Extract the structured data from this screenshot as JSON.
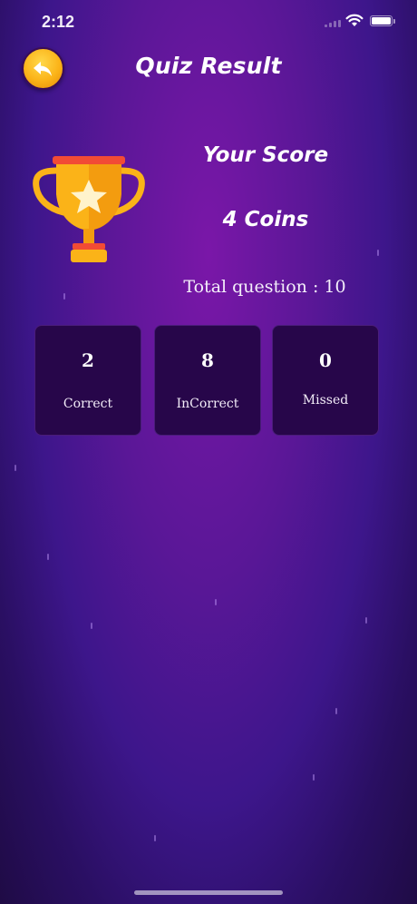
{
  "status_bar": {
    "time": "2:12",
    "icons": [
      "signal-icon",
      "wifi-icon",
      "battery-icon"
    ]
  },
  "header": {
    "title": "Quiz Result",
    "back_icon": "back-arrow-icon"
  },
  "score": {
    "label": "Your Score",
    "coins": "4 Coins",
    "total_question": "Total question : 10"
  },
  "stats": [
    {
      "value": "2",
      "label": "Correct"
    },
    {
      "value": "8",
      "label": "InCorrect"
    },
    {
      "value": "0",
      "label": "Missed"
    }
  ],
  "colors": {
    "background": "#5a1797",
    "card": "#27064a",
    "accent": "#fbb318"
  }
}
